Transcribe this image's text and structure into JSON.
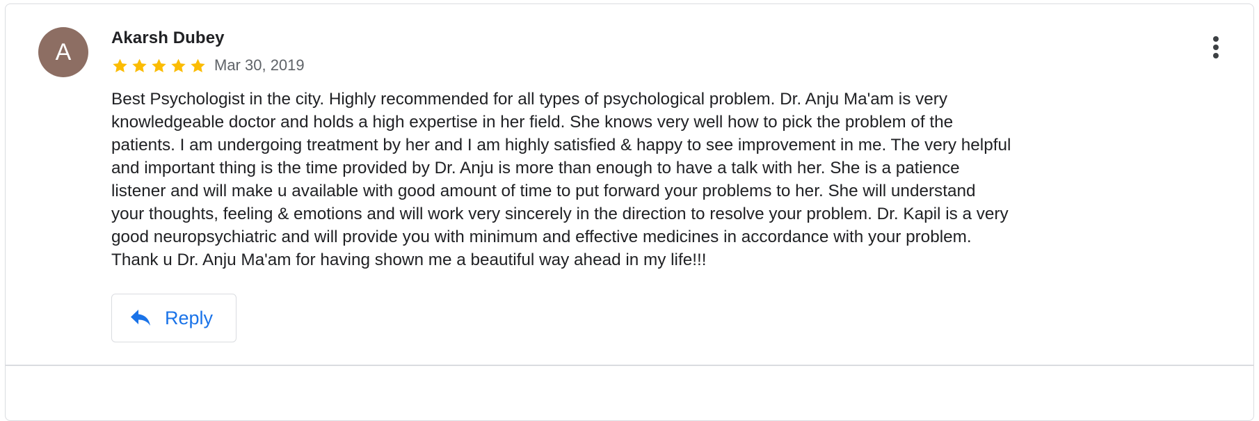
{
  "review": {
    "avatar_initial": "A",
    "reviewer_name": "Akarsh Dubey",
    "rating": 5,
    "rating_max": 5,
    "date": "Mar 30, 2019",
    "text": "Best Psychologist in the city. Highly recommended for all types of psychological problem. Dr. Anju Ma'am is very\nknowledgeable doctor and holds a high expertise in her field. She knows very well how to pick the problem of the\npatients. I am undergoing treatment by her and I am highly satisfied & happy to see improvement in me. The very helpful\nand important thing is the time provided by Dr. Anju is more than enough to have a talk with her. She is a patience\nlistener and will make u available with good amount of time to put forward your problems to her. She will understand\nyour thoughts, feeling & emotions and will work very sincerely in the direction to resolve your problem. Dr. Kapil is a very\ngood neuropsychiatric and will provide you with minimum and effective medicines in accordance with your problem.\nThank u Dr. Anju Ma'am for having shown me a beautiful way ahead in my life!!!"
  },
  "actions": {
    "reply_label": "Reply",
    "reply_icon": "reply-arrow-icon",
    "more_icon": "more-vert-icon"
  },
  "colors": {
    "avatar_bg": "#8d6e63",
    "star": "#fbbc04",
    "link": "#1a73e8",
    "border": "#dadce0",
    "meta_text": "#5f6368"
  }
}
